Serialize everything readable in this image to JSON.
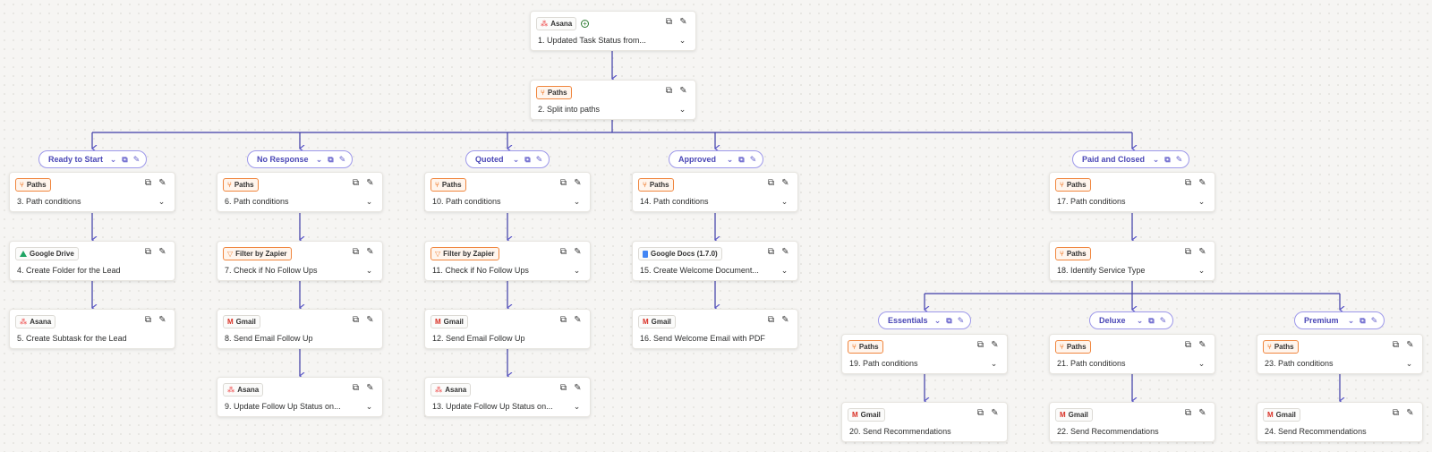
{
  "colors": {
    "connector": "#3c3aa6",
    "paths_accent": "#f0863e",
    "path_label": "#4a47b6"
  },
  "trigger": {
    "app": "Asana",
    "title": "1. Updated Task Status from...",
    "icon": "asana-icon",
    "add_icon": "plus-circle-icon"
  },
  "split": {
    "app": "Paths",
    "title": "2. Split into paths"
  },
  "branches": {
    "ready": {
      "label": "Ready to Start",
      "steps": [
        {
          "app": "Paths",
          "title": "3. Path conditions"
        },
        {
          "app": "Google Drive",
          "title": "4. Create Folder for the Lead"
        },
        {
          "app": "Asana",
          "title": "5. Create Subtask for the Lead"
        }
      ]
    },
    "noresponse": {
      "label": "No Response",
      "steps": [
        {
          "app": "Paths",
          "title": "6. Path conditions"
        },
        {
          "app": "Filter by Zapier",
          "title": "7. Check if No Follow Ups"
        },
        {
          "app": "Gmail",
          "title": "8. Send Email Follow Up"
        },
        {
          "app": "Asana",
          "title": "9. Update Follow Up Status on..."
        }
      ]
    },
    "quoted": {
      "label": "Quoted",
      "steps": [
        {
          "app": "Paths",
          "title": "10. Path conditions"
        },
        {
          "app": "Filter by Zapier",
          "title": "11. Check if No Follow Ups"
        },
        {
          "app": "Gmail",
          "title": "12. Send Email Follow Up"
        },
        {
          "app": "Asana",
          "title": "13. Update Follow Up Status on..."
        }
      ]
    },
    "approved": {
      "label": "Approved",
      "steps": [
        {
          "app": "Paths",
          "title": "14. Path conditions"
        },
        {
          "app": "Google Docs (1.7.0)",
          "title": "15. Create Welcome Document..."
        },
        {
          "app": "Gmail",
          "title": "16. Send Welcome Email with PDF"
        }
      ]
    },
    "paid": {
      "label": "Paid and Closed",
      "steps": [
        {
          "app": "Paths",
          "title": "17. Path conditions"
        },
        {
          "app": "Paths",
          "title": "18. Identify Service Type"
        }
      ],
      "sub": {
        "essentials": {
          "label": "Essentials",
          "steps": [
            {
              "app": "Paths",
              "title": "19. Path conditions"
            },
            {
              "app": "Gmail",
              "title": "20. Send Recommendations"
            }
          ]
        },
        "deluxe": {
          "label": "Deluxe",
          "steps": [
            {
              "app": "Paths",
              "title": "21. Path conditions"
            },
            {
              "app": "Gmail",
              "title": "22. Send Recommendations"
            }
          ]
        },
        "premium": {
          "label": "Premium",
          "steps": [
            {
              "app": "Paths",
              "title": "23. Path conditions"
            },
            {
              "app": "Gmail",
              "title": "24. Send Recommendations"
            }
          ]
        }
      }
    }
  }
}
